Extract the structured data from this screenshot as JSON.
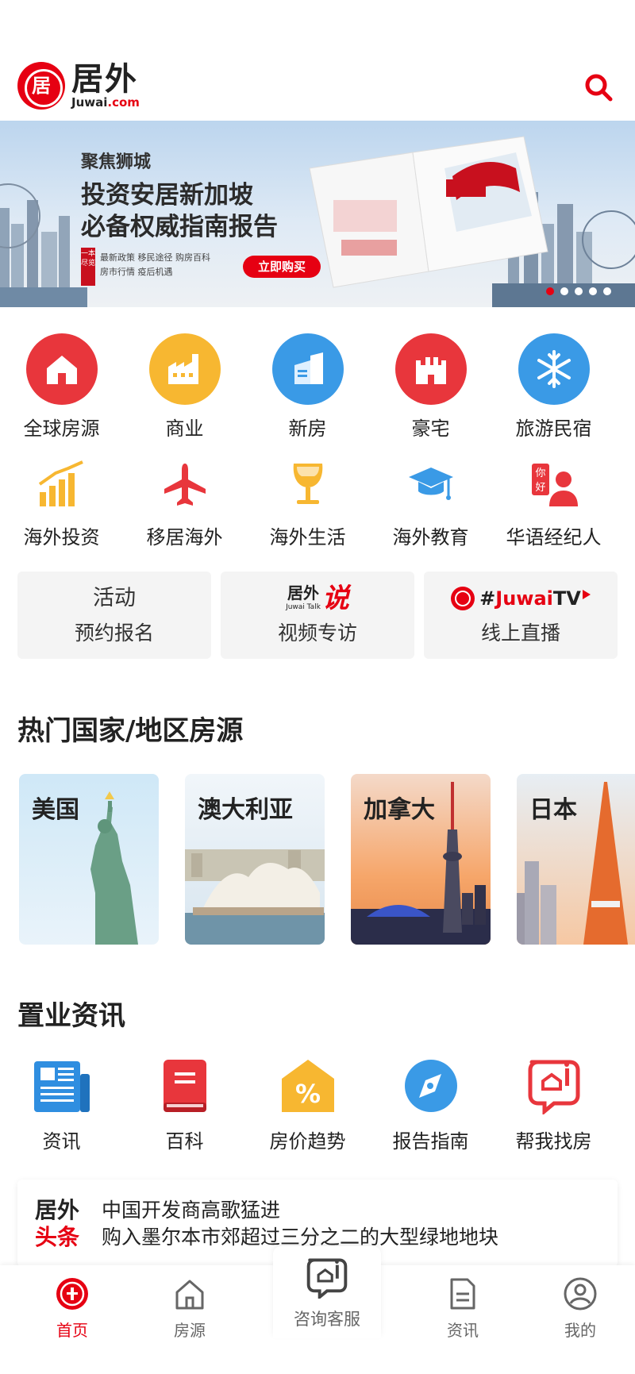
{
  "header": {
    "logo_cn": "居外",
    "logo_en_main": "Juwai",
    "logo_en_suffix": ".com",
    "logo_glyph": "居"
  },
  "banner": {
    "kicker": "聚焦狮城",
    "title1": "投资安居新加坡",
    "title2": "必备权威指南报告",
    "vtag": "一本尽览",
    "tags_line1": "最新政策  移民途径  购房百科",
    "tags_line2": "房市行情  疫后机遇",
    "cta": "立即购买",
    "dot_count": 5,
    "active_dot": 0
  },
  "categories_row1": [
    {
      "label": "全球房源",
      "icon": "house-icon",
      "color": "#e8363c"
    },
    {
      "label": "商业",
      "icon": "factory-icon",
      "color": "#f7b731"
    },
    {
      "label": "新房",
      "icon": "building-icon",
      "color": "#3a9ae6"
    },
    {
      "label": "豪宅",
      "icon": "castle-icon",
      "color": "#e8363c"
    },
    {
      "label": "旅游民宿",
      "icon": "snowflake-icon",
      "color": "#3a9ae6"
    }
  ],
  "categories_row2": [
    {
      "label": "海外投资",
      "icon": "chart-icon"
    },
    {
      "label": "移居海外",
      "icon": "airplane-icon"
    },
    {
      "label": "海外生活",
      "icon": "wine-glass-icon"
    },
    {
      "label": "海外教育",
      "icon": "graduation-cap-icon"
    },
    {
      "label": "华语经纪人",
      "icon": "agent-icon"
    }
  ],
  "promos": [
    {
      "top": "活动",
      "bottom": "预约报名"
    },
    {
      "top_logo": "居外",
      "top_logo_sub": "Juwai Talk",
      "top_accent": "说",
      "bottom": "视频专访"
    },
    {
      "top_hash": "#",
      "top_brand": "Juwai",
      "top_tv": "TV",
      "bottom": "线上直播"
    }
  ],
  "hot_section": {
    "title": "热门国家/地区房源"
  },
  "countries": [
    {
      "name": "美国"
    },
    {
      "name": "澳大利亚"
    },
    {
      "name": "加拿大"
    },
    {
      "name": "日本"
    }
  ],
  "news_section": {
    "title": "置业资讯"
  },
  "news_items": [
    {
      "label": "资讯",
      "icon": "newspaper-icon"
    },
    {
      "label": "百科",
      "icon": "book-icon"
    },
    {
      "label": "房价趋势",
      "icon": "percent-house-icon"
    },
    {
      "label": "报告指南",
      "icon": "compass-icon"
    },
    {
      "label": "帮我找房",
      "icon": "chat-house-icon"
    }
  ],
  "headline": {
    "brand1": "居外",
    "brand2": "头条",
    "line1": "中国开发商高歌猛进",
    "line2": "购入墨尔本市郊超过三分之二的大型绿地地块"
  },
  "tabbar": {
    "home": "首页",
    "listings": "房源",
    "consult": "咨询客服",
    "news": "资讯",
    "mine": "我的"
  },
  "colors": {
    "brand_red": "#e60012",
    "blue": "#3a9ae6",
    "yellow": "#f7b731"
  }
}
